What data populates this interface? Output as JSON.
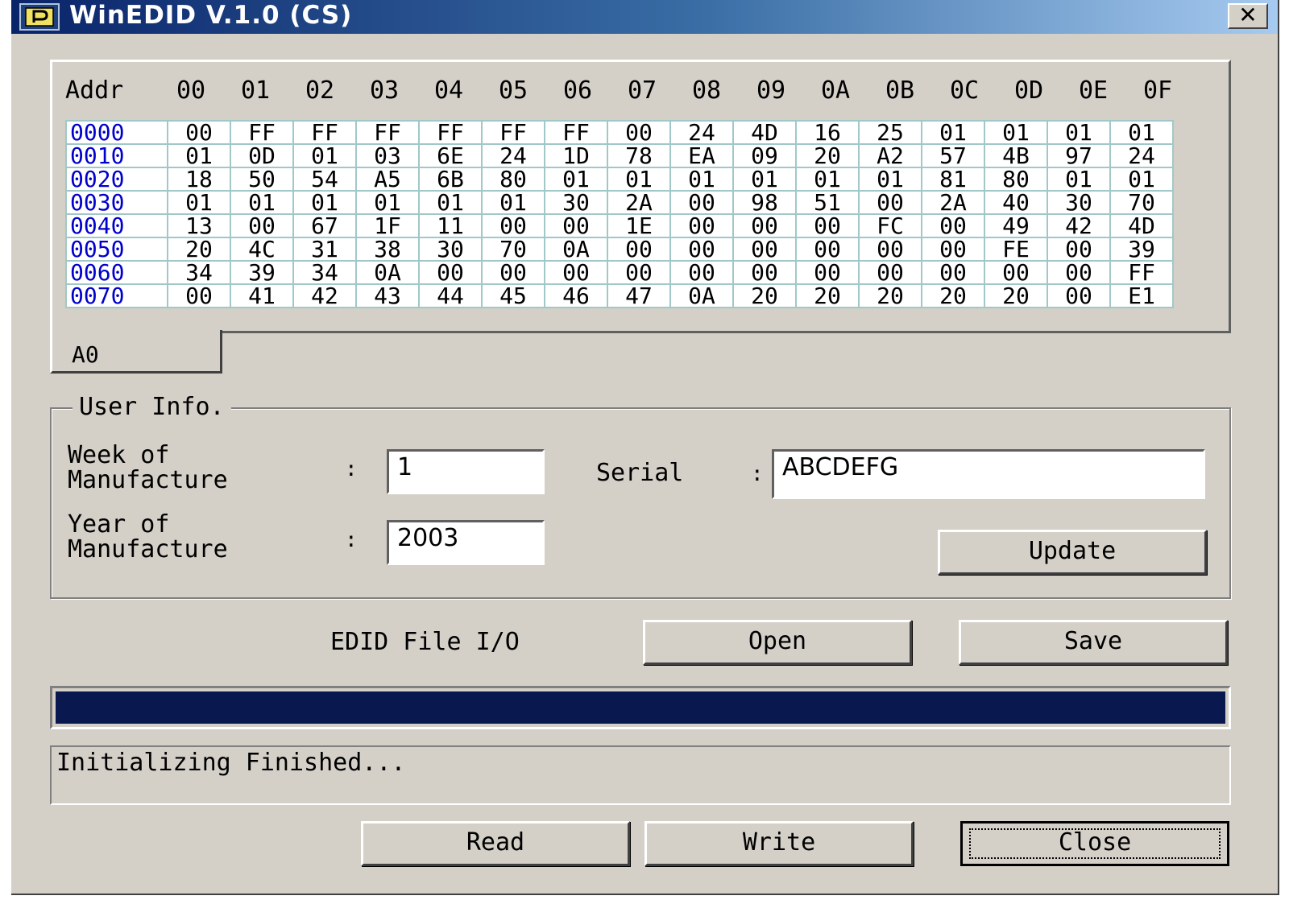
{
  "window": {
    "title": "WinEDID V.1.0 (CS)",
    "close_glyph": "✕"
  },
  "hex": {
    "header_label": "Addr",
    "columns": [
      "00",
      "01",
      "02",
      "03",
      "04",
      "05",
      "06",
      "07",
      "08",
      "09",
      "0A",
      "0B",
      "0C",
      "0D",
      "0E",
      "0F"
    ],
    "rows": [
      {
        "addr": "0000",
        "bytes": [
          "00",
          "FF",
          "FF",
          "FF",
          "FF",
          "FF",
          "FF",
          "00",
          "24",
          "4D",
          "16",
          "25",
          "01",
          "01",
          "01",
          "01"
        ]
      },
      {
        "addr": "0010",
        "bytes": [
          "01",
          "0D",
          "01",
          "03",
          "6E",
          "24",
          "1D",
          "78",
          "EA",
          "09",
          "20",
          "A2",
          "57",
          "4B",
          "97",
          "24"
        ]
      },
      {
        "addr": "0020",
        "bytes": [
          "18",
          "50",
          "54",
          "A5",
          "6B",
          "80",
          "01",
          "01",
          "01",
          "01",
          "01",
          "01",
          "81",
          "80",
          "01",
          "01"
        ]
      },
      {
        "addr": "0030",
        "bytes": [
          "01",
          "01",
          "01",
          "01",
          "01",
          "01",
          "30",
          "2A",
          "00",
          "98",
          "51",
          "00",
          "2A",
          "40",
          "30",
          "70"
        ]
      },
      {
        "addr": "0040",
        "bytes": [
          "13",
          "00",
          "67",
          "1F",
          "11",
          "00",
          "00",
          "1E",
          "00",
          "00",
          "00",
          "FC",
          "00",
          "49",
          "42",
          "4D"
        ]
      },
      {
        "addr": "0050",
        "bytes": [
          "20",
          "4C",
          "31",
          "38",
          "30",
          "70",
          "0A",
          "00",
          "00",
          "00",
          "00",
          "00",
          "00",
          "FE",
          "00",
          "39"
        ]
      },
      {
        "addr": "0060",
        "bytes": [
          "34",
          "39",
          "34",
          "0A",
          "00",
          "00",
          "00",
          "00",
          "00",
          "00",
          "00",
          "00",
          "00",
          "00",
          "00",
          "FF"
        ]
      },
      {
        "addr": "0070",
        "bytes": [
          "00",
          "41",
          "42",
          "43",
          "44",
          "45",
          "46",
          "47",
          "0A",
          "20",
          "20",
          "20",
          "20",
          "20",
          "00",
          "E1"
        ]
      }
    ],
    "address_color": "#0000cc",
    "grid_line_color": "#a0c8c8"
  },
  "tab": {
    "label": "A0"
  },
  "user_info": {
    "legend": "User Info.",
    "week_label": "Week of\nManufacture",
    "week_value": "1",
    "year_label": "Year of\nManufacture",
    "year_value": "2003",
    "serial_label": "Serial",
    "serial_value": "ABCDEFG",
    "colon": ":",
    "update_button": "Update"
  },
  "file_io": {
    "label": "EDID File I/O",
    "open_button": "Open",
    "save_button": "Save"
  },
  "progress": {
    "fraction": 1.0,
    "color": "#0a1850"
  },
  "status": {
    "text": "Initializing Finished..."
  },
  "actions": {
    "read_button": "Read",
    "write_button": "Write",
    "close_button": "Close"
  },
  "icons": {
    "app": "edid-app-icon",
    "close": "close-icon"
  },
  "colors": {
    "window_bg": "#d4d0c8",
    "titlebar_start": "#0a246a",
    "titlebar_end": "#a6caf0"
  }
}
